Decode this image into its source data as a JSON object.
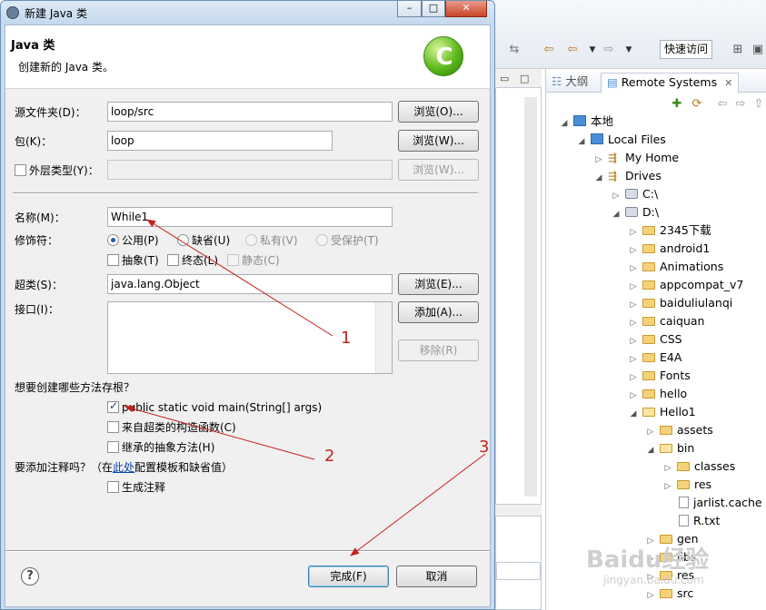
{
  "window": {
    "title": "新建 Java 类",
    "min": "–",
    "max": "□",
    "close": "✕"
  },
  "header": {
    "title": "Java 类",
    "description": "创建新的 Java 类。",
    "logo_letter": "C"
  },
  "form": {
    "source_folder": {
      "label": "源文件夹(D)：",
      "value": "loop/src",
      "browse": "浏览(O)..."
    },
    "package": {
      "label": "包(K)：",
      "value": "loop",
      "browse": "浏览(W)..."
    },
    "enclosing_type": {
      "label": "外层类型(Y)：",
      "value": "",
      "browse": "浏览(W)..."
    },
    "name": {
      "label": "名称(M)：",
      "value": "While1"
    },
    "modifiers": {
      "label": "修饰符：",
      "access": [
        "公用(P)",
        "缺省(U)",
        "私有(V)",
        "受保护(T)"
      ],
      "other": [
        "抽象(T)",
        "终态(L)",
        "静态(C)"
      ]
    },
    "superclass": {
      "label": "超类(S)：",
      "value": "java.lang.Object",
      "browse": "浏览(E)..."
    },
    "interfaces": {
      "label": "接口(I)：",
      "add": "添加(A)...",
      "remove": "移除(R)"
    },
    "stubs": {
      "question": "想要创建哪些方法存根？",
      "main": "public static void main(String[] args)",
      "constructors": "来自超类的构造函数(C)",
      "inherited": "继承的抽象方法(H)"
    },
    "comments": {
      "question_prefix": "要添加注释吗？（在",
      "link": "此处",
      "question_suffix": "配置模板和缺省值）",
      "generate": "生成注释"
    }
  },
  "buttons": {
    "help": "?",
    "finish": "完成(F)",
    "cancel": "取消"
  },
  "eclipse": {
    "quick_access": "快速访问",
    "tabs": {
      "outline": "大纲",
      "remote": "Remote Systems",
      "close": "✕"
    },
    "tree": [
      {
        "label": "本地",
        "depth": 0
      },
      {
        "label": "Local Files",
        "depth": 1
      },
      {
        "label": "My Home",
        "depth": 2
      },
      {
        "label": "Drives",
        "depth": 2
      },
      {
        "label": "C:\\",
        "depth": 3
      },
      {
        "label": "D:\\",
        "depth": 3
      },
      {
        "label": "2345下载",
        "depth": 4
      },
      {
        "label": "android1",
        "depth": 4
      },
      {
        "label": "Animations",
        "depth": 4
      },
      {
        "label": "appcompat_v7",
        "depth": 4
      },
      {
        "label": "baiduliulanqi",
        "depth": 4
      },
      {
        "label": "caiquan",
        "depth": 4
      },
      {
        "label": "CSS",
        "depth": 4
      },
      {
        "label": "E4A",
        "depth": 4
      },
      {
        "label": "Fonts",
        "depth": 4
      },
      {
        "label": "hello",
        "depth": 4
      },
      {
        "label": "Hello1",
        "depth": 4
      },
      {
        "label": "assets",
        "depth": 5
      },
      {
        "label": "bin",
        "depth": 5
      },
      {
        "label": "classes",
        "depth": 6
      },
      {
        "label": "res",
        "depth": 6
      },
      {
        "label": "jarlist.cache",
        "depth": 6
      },
      {
        "label": "R.txt",
        "depth": 6
      },
      {
        "label": "gen",
        "depth": 5
      },
      {
        "label": "libs",
        "depth": 5
      },
      {
        "label": "res",
        "depth": 5
      },
      {
        "label": "src",
        "depth": 5
      }
    ]
  },
  "annotations": {
    "n1": "1",
    "n2": "2",
    "n3": "3"
  },
  "watermark": {
    "brand": "Baidu经验",
    "url": "jingyan.baidu.com"
  },
  "colors": {
    "annotation": "#c8201c",
    "logo": "#5cb81c",
    "link": "#0645ad"
  }
}
